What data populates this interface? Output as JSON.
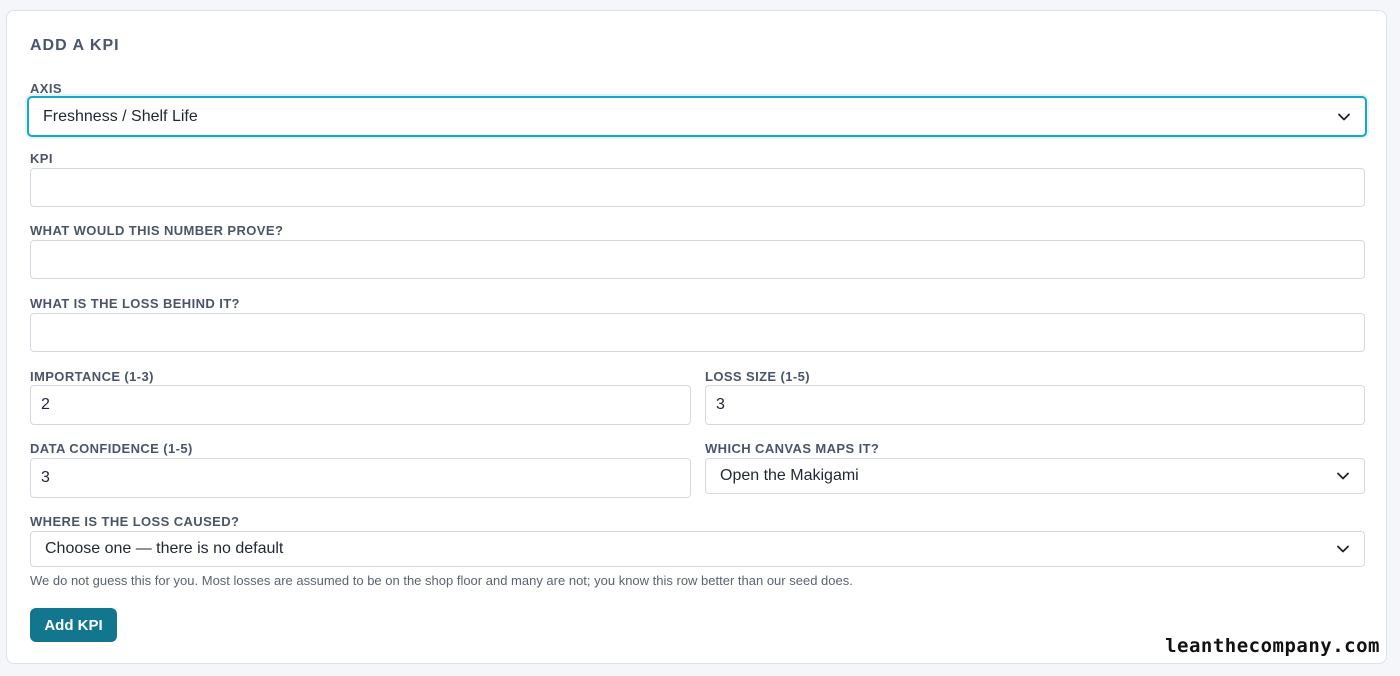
{
  "card": {
    "title": "ADD A KPI"
  },
  "axis": {
    "label": "AXIS",
    "value": "Freshness / Shelf Life"
  },
  "kpi": {
    "label": "KPI",
    "value": ""
  },
  "prove": {
    "label": "WHAT WOULD THIS NUMBER PROVE?",
    "value": ""
  },
  "loss": {
    "label": "WHAT IS THE LOSS BEHIND IT?",
    "value": ""
  },
  "importance": {
    "label": "IMPORTANCE (1-3)",
    "value": "2"
  },
  "loss_size": {
    "label": "LOSS SIZE (1-5)",
    "value": "3"
  },
  "confidence": {
    "label": "DATA CONFIDENCE (1-5)",
    "value": "3"
  },
  "canvas": {
    "label": "WHICH CANVAS MAPS IT?",
    "value": "Open the Makigami"
  },
  "caused": {
    "label": "WHERE IS THE LOSS CAUSED?",
    "value": "Choose one — there is no default",
    "hint": "We do not guess this for you. Most losses are assumed to be on the shop floor and many are not; you know this row better than our seed does."
  },
  "submit": {
    "label": "Add KPI"
  },
  "watermark": "leanthecompany.com",
  "colors": {
    "accent": "#13768f",
    "focus": "#19a8c4"
  },
  "icons": {
    "select_arrow": "chevron-down-icon"
  }
}
